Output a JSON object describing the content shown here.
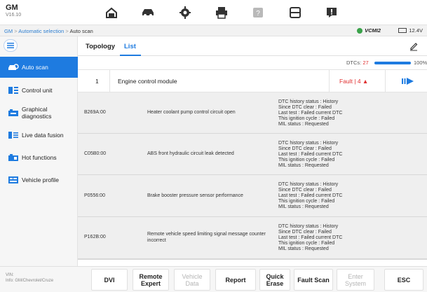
{
  "app": {
    "make": "GM",
    "version": "V16.10"
  },
  "toolbar": {
    "icons": [
      "home-icon",
      "vehicle-icon",
      "settings-icon",
      "printer-icon",
      "help-icon",
      "save-icon",
      "feedback-icon"
    ]
  },
  "breadcrumb": {
    "root": "GM",
    "separator": ">",
    "parent": "Automatic selection",
    "current": "Auto scan"
  },
  "status": {
    "vci_label": "VCMI2",
    "voltage": "12.4V"
  },
  "sidebar": {
    "items": [
      {
        "label": "Auto scan",
        "icon": "car-scan-icon",
        "active": true
      },
      {
        "label": "Control unit",
        "icon": "control-unit-icon",
        "active": false
      },
      {
        "label": "Graphical diagnostics",
        "icon": "graphical-diagnostics-icon",
        "active": false
      },
      {
        "label": "Live data fusion",
        "icon": "live-data-icon",
        "active": false
      },
      {
        "label": "Hot functions",
        "icon": "hot-functions-icon",
        "active": false
      },
      {
        "label": "Vehicle profile",
        "icon": "vehicle-profile-icon",
        "active": false
      }
    ]
  },
  "tabs": [
    {
      "label": "Topology",
      "active": false
    },
    {
      "label": "List",
      "active": true
    }
  ],
  "summary": {
    "dtcs_label": "DTCs:",
    "dtcs_count": "27",
    "progress": 1.0,
    "progress_text": "100%"
  },
  "module": {
    "index": "1",
    "name": "Engine control module",
    "status": "Fault | 4 ▲"
  },
  "dtcs": [
    {
      "code": "B269A:00",
      "description": "Heater coolant pump control circuit open",
      "details": [
        "DTC history status : History",
        "Since DTC clear : Failed",
        "Last test : Failed current DTC",
        "This ignition cycle : Failed",
        "MIL status : Requested"
      ]
    },
    {
      "code": "C05B0:00",
      "description": "ABS front hydraulic circuit leak detected",
      "details": [
        "DTC history status : History",
        "Since DTC clear : Failed",
        "Last test : Failed current DTC",
        "This ignition cycle : Failed",
        "MIL status : Requested"
      ]
    },
    {
      "code": "P0556:00",
      "description": "Brake booster pressure sensor performance",
      "details": [
        "DTC history status : History",
        "Since DTC clear : Failed",
        "Last test : Failed current DTC",
        "This ignition cycle : Failed",
        "MIL status : Requested"
      ]
    },
    {
      "code": "P162B:00",
      "description": "Remote vehicle speed limiting signal message counter incorrect",
      "details": [
        "DTC history status : History",
        "Since DTC clear : Failed",
        "Last test : Failed current DTC",
        "This ignition cycle : Failed",
        "MIL status : Requested"
      ]
    }
  ],
  "vehicle_info": {
    "vin_label": "VIN:",
    "info": "Info: GM/Chevrolet/Cruze"
  },
  "buttons": {
    "dvi": "DVI",
    "remote_expert": "Remote Expert",
    "vehicle_data": "Vehicle Data",
    "report": "Report",
    "quick_erase": "Quick Erase",
    "fault_scan": "Fault Scan",
    "enter_system": "Enter System",
    "esc": "ESC"
  },
  "colors": {
    "accent": "#1e7be0",
    "fault": "#e03030",
    "vci_ok": "#3aa24a"
  }
}
